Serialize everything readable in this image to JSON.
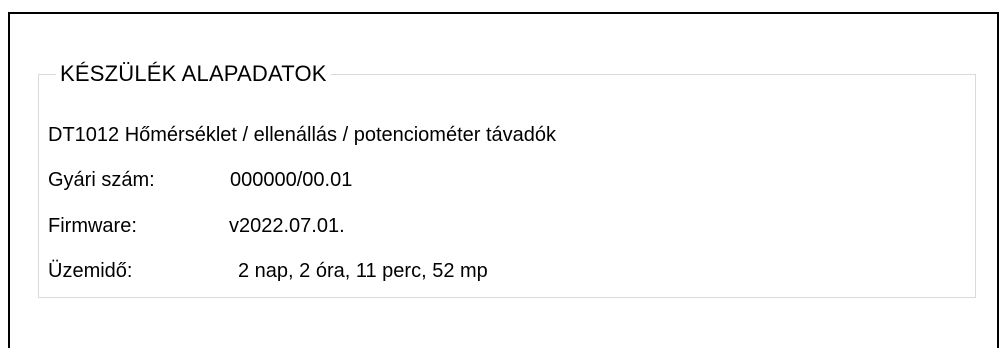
{
  "device_basic_data": {
    "title": "KÉSZÜLÉK ALAPADATOK",
    "model_description": "DT1012 Hőmérséklet / ellenállás / potenciométer távadók",
    "serial": {
      "label": "Gyári szám:",
      "value": "000000/00.01"
    },
    "firmware": {
      "label": "Firmware:",
      "value": "v2022.07.01."
    },
    "uptime": {
      "label": "Üzemidő:",
      "value": "2 nap, 2 óra, 11 perc, 52 mp"
    }
  }
}
